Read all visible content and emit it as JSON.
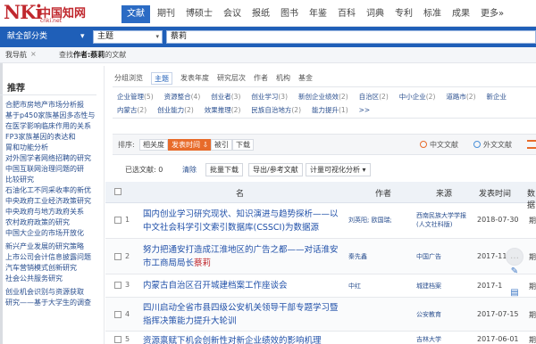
{
  "header": {
    "logo_big": "NKi",
    "logo_cn": "中国知网",
    "logo_sub": "cnki.net",
    "nav": [
      "文献",
      "期刊",
      "博硕士",
      "会议",
      "报纸",
      "图书",
      "年鉴",
      "百科",
      "词典",
      "专利",
      "标准",
      "成果",
      "更多»"
    ],
    "nav_active": 0
  },
  "search": {
    "category_label": "献全部分类",
    "category_caret": "▾",
    "field": "主题",
    "field_caret": "▾",
    "query": "蔡莉"
  },
  "breadcrumb": {
    "first": "我导航",
    "close": "×",
    "prefix": "查找",
    "bold": "作者:蔡莉",
    "suffix": "的文献"
  },
  "sidebar": {
    "title": "推荐",
    "items": [
      "合肥市房地产市场分析报",
      "基于p450家族基因多态性与",
      "在医学影响临床作用的关系",
      "FP3家族基因的表达和",
      "胃和功能分析",
      "对外国学者网络招聘的研究",
      "中国互联网治理问题的研",
      "比较研究",
      "石油化工不同采收率的新优",
      "",
      "中央政府工业经济政策研究",
      "中央政府与地方政府关系",
      "农村政府政策的研究",
      "中国大企业的市场开放化",
      "",
      "新兴产业发展的研究策略",
      "上市公司会计信息披露问题",
      "汽车营销模式创新研究",
      "社会公共服务研究",
      "",
      "创业机会识别与资源获取",
      "研究——基于大学生的调查"
    ]
  },
  "filters": {
    "tabs": [
      "分组浏览",
      "主题",
      "发表年度",
      "研究层次",
      "作者",
      "机构",
      "基金"
    ],
    "active_tab": 1,
    "row1": [
      {
        "label": "企业管理",
        "count": "(5)"
      },
      {
        "label": "资源整合",
        "count": "(4)"
      },
      {
        "label": "创业者",
        "count": "(3)"
      },
      {
        "label": "创业学习",
        "count": "(3)"
      },
      {
        "label": "新创企业绩效",
        "count": "(2)"
      },
      {
        "label": "自治区",
        "count": "(2)"
      },
      {
        "label": "中小企业",
        "count": "(2)"
      },
      {
        "label": "道路市",
        "count": "(2)"
      },
      {
        "label": "新企业",
        "count": ""
      }
    ],
    "row2": [
      {
        "label": "内蒙古",
        "count": "(2)"
      },
      {
        "label": "创业能力",
        "count": "(2)"
      },
      {
        "label": "效果推理",
        "count": "(2)"
      },
      {
        "label": "民族自治地方",
        "count": "(2)"
      },
      {
        "label": "能力提升",
        "count": "(1)"
      },
      {
        "label": ">>",
        "count": ""
      }
    ]
  },
  "sort": {
    "label": "排序:",
    "options": [
      "相关度",
      "发表时间 ⇩",
      "被引",
      "下载"
    ],
    "active": 1,
    "lang_cn": "中文文献",
    "lang_en": "外文文献"
  },
  "actions": {
    "selected_label": "已选文献: 0",
    "clear": "清除",
    "buttons": [
      "批量下载",
      "导出/参考文献",
      "计量可视化分析 ▾"
    ]
  },
  "table": {
    "headers": [
      "名",
      "作者",
      "来源",
      "发表时间",
      "数据"
    ],
    "rows": [
      {
        "num": "1",
        "title_pre": "国内创业学习研究现状、知识演进与趋势探析——以中文社会科学引文索引数据库(CSSCI)为数据源",
        "title_hl": "",
        "title_post": "",
        "author": "刘英阳; 欧国瑞; 蔡莉",
        "source": "西南民族大学学报(人文社科版)",
        "date": "2018-07-30",
        "db": "期"
      },
      {
        "num": "2",
        "title_pre": "努力把通安打造成江淮地区的广告之都——对话淮安市工商局局长",
        "title_hl": "蔡莉",
        "title_post": "",
        "author": "秦先鑫",
        "source": "中国广告",
        "date": "2017-11",
        "db": "期"
      },
      {
        "num": "3",
        "title_pre": "内蒙古自治区召开城建档案工作座谈会",
        "title_hl": "",
        "title_post": "",
        "author": "中红",
        "source": "城建档案",
        "date": "2017-1",
        "db": "期"
      },
      {
        "num": "4",
        "title_pre": "四川启动全省市县四级公安机关领导干部专题学习暨指挥决策能力提升大轮训",
        "title_hl": "",
        "title_post": "",
        "author": "",
        "source": "公安教育",
        "date": "2017-07-15",
        "db": "期"
      },
      {
        "num": "5",
        "title_pre": "资源禀赋下机会创新性对新企业绩效的影响机理",
        "title_hl": "",
        "title_post": "",
        "author": "",
        "source": "吉林大学",
        "date": "2017-06-01",
        "db": "期"
      }
    ]
  },
  "float_tools": {
    "chat": "…",
    "edit": "✎",
    "doc": "▤"
  },
  "colors": {
    "brand_red": "#c0282e",
    "nav_blue": "#2b6bc4",
    "search_bar_blue": "#1f5fb8",
    "sort_active_orange": "#e86b2a",
    "link_blue": "#1f4fa8"
  }
}
